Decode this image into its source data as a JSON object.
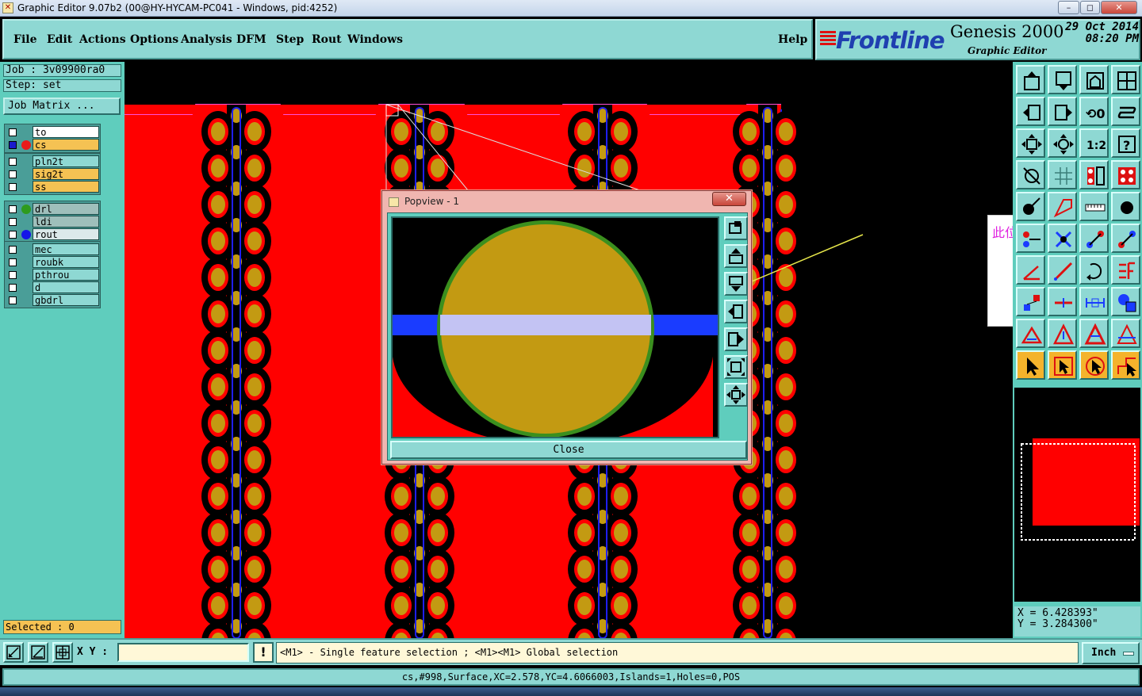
{
  "window": {
    "title": "Graphic Editor 9.07b2 (00@HY-HYCAM-PC041 - Windows, pid:4252)",
    "controls": [
      "–",
      "◻",
      "✕"
    ]
  },
  "menu": {
    "items": [
      "File",
      "Edit",
      "Actions",
      "Options",
      "Analysis",
      "DFM",
      "Step",
      "Rout",
      "Windows"
    ],
    "help": "Help"
  },
  "brand": {
    "logo": "Frontline",
    "product": "Genesis 2000",
    "subtitle": "Graphic Editor",
    "date": "29 Oct 2014",
    "time": "08:20 PM"
  },
  "job": {
    "job_line": "Job : 3v09900ra0",
    "step_line": "Step: set",
    "matrix_button": "Job Matrix ..."
  },
  "layers": [
    [
      {
        "name": "to",
        "bg": "#ffffff",
        "dot": "",
        "checked": false
      },
      {
        "name": "cs",
        "bg": "#f5c253",
        "dot": "#e81b1b",
        "checked": true
      }
    ],
    [
      {
        "name": "pln2t",
        "bg": "#8ed8d3",
        "dot": "",
        "checked": false
      },
      {
        "name": "sig2t",
        "bg": "#f5c253",
        "dot": "",
        "checked": false
      },
      {
        "name": "ss",
        "bg": "#f5c253",
        "dot": "",
        "checked": false
      }
    ],
    [
      {
        "name": "drl",
        "bg": "#9fbfbb",
        "dot": "#2e9b1e",
        "checked": false
      },
      {
        "name": "ldi",
        "bg": "#9fbfbb",
        "dot": "",
        "checked": false
      },
      {
        "name": "rout",
        "bg": "#dce9ea",
        "dot": "#1515e8",
        "checked": false
      }
    ],
    [
      {
        "name": "mec",
        "bg": "#8ed8d3",
        "dot": "",
        "checked": false
      },
      {
        "name": "roubk",
        "bg": "#8ed8d3",
        "dot": "",
        "checked": false
      },
      {
        "name": "pthrou",
        "bg": "#8ed8d3",
        "dot": "",
        "checked": false
      },
      {
        "name": "d",
        "bg": "#8ed8d3",
        "dot": "",
        "checked": false
      },
      {
        "name": "gbdrl",
        "bg": "#8ed8d3",
        "dot": "",
        "checked": false
      }
    ]
  ],
  "selected": "Selected : 0",
  "popview": {
    "title": "Popview - 1",
    "close_x": "✕",
    "close_button": "Close"
  },
  "note": "此位置不削铜",
  "toolbar_icons": [
    "layer-up-icon",
    "layer-down-icon",
    "home-icon",
    "window-icon",
    "pan-left-icon",
    "pan-right-icon",
    "rotate-icon",
    "snake-icon",
    "zoom-fit-icon",
    "zoom-center-icon",
    "scale-1-2-icon",
    "help-icon",
    "measure-icon",
    "grid-icon",
    "pads-icon",
    "pads-red-icon",
    "pointer-icon",
    "polygon-icon",
    "ruler-icon",
    "circle-icon",
    "node-icon",
    "cross-icon",
    "link-icon",
    "link-red-icon",
    "angle-icon",
    "line-icon",
    "arc-icon",
    "split-icon",
    "connect-icon",
    "dash-icon",
    "dimension-icon",
    "shapes-icon",
    "triangle-icon",
    "triangle-b-icon",
    "triangle-c-icon",
    "triangle-d-icon",
    "select-icon",
    "select-box-icon",
    "select-circle-icon",
    "select-path-icon"
  ],
  "coords": {
    "x": "X = 6.428393\"",
    "y": "Y = 3.284300\""
  },
  "command": {
    "xy_label": "X Y :",
    "xy_value": "",
    "warn": "!",
    "hint": "<M1> - Single feature selection ; <M1><M1> Global selection",
    "unit": "Inch"
  },
  "status": "cs,#998,Surface,XC=2.578,YC=4.6066003,Islands=1,Holes=0,POS",
  "colors": {
    "copper": "#ff0000",
    "pad": "#c39a12",
    "rout": "#1f1ff0",
    "teal": "#5fcdbd"
  }
}
